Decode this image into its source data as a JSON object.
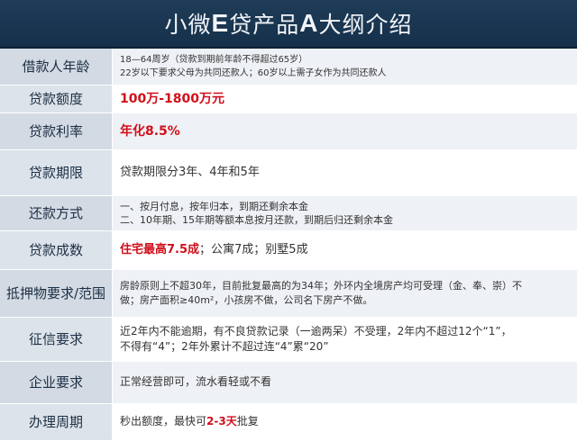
{
  "header": {
    "title_p1": "小微",
    "title_p2": "E",
    "title_p3": "贷产品",
    "title_p4": "A",
    "title_p5": "大纲介绍"
  },
  "rows": {
    "age": {
      "label": "借款人年龄",
      "line1": "18—64周岁（贷款到期前年龄不得超过65岁）",
      "line2": "22岁以下要求父母为共同还款人；60岁以上需子女作为共同还款人"
    },
    "amount": {
      "label": "贷款额度",
      "value": "100万-1800万元"
    },
    "rate": {
      "label": "贷款利率",
      "value": "年化8.5%"
    },
    "term": {
      "label": "贷款期限",
      "value": "贷款期限分3年、4年和5年"
    },
    "repay": {
      "label": "还款方式",
      "line1": "一、按月付息，按年归本，到期还剩余本金",
      "line2": "二、10年期、15年期等额本息按月还款，到期后归还剩余本金"
    },
    "ltv": {
      "label": "贷款成数",
      "highlight": "住宅最高7.5成",
      "rest": "；公寓7成；别墅5成"
    },
    "collateral": {
      "label": "抵押物要求/范围",
      "line1": "房龄原则上不超30年，目前批复最高的为34年；外环内全境房产均可受理（金、奉、崇）不",
      "line2": "做；房产面积≥40m²，小孩房不做，公司名下房产不做。"
    },
    "credit": {
      "label": "征信要求",
      "line1": "近2年内不能逾期，有不良贷款记录（一逾两呆）不受理，2年内不超过12个“1”，",
      "line2": "不得有“4”；2年外累计不超过连“4”累“20”"
    },
    "company": {
      "label": "企业要求",
      "value": "正常经营即可，流水看轻或不看"
    },
    "cycle": {
      "label": "办理周期",
      "pre": "秒出额度，最快可",
      "highlight": "2-3天",
      "post": "批复"
    }
  }
}
